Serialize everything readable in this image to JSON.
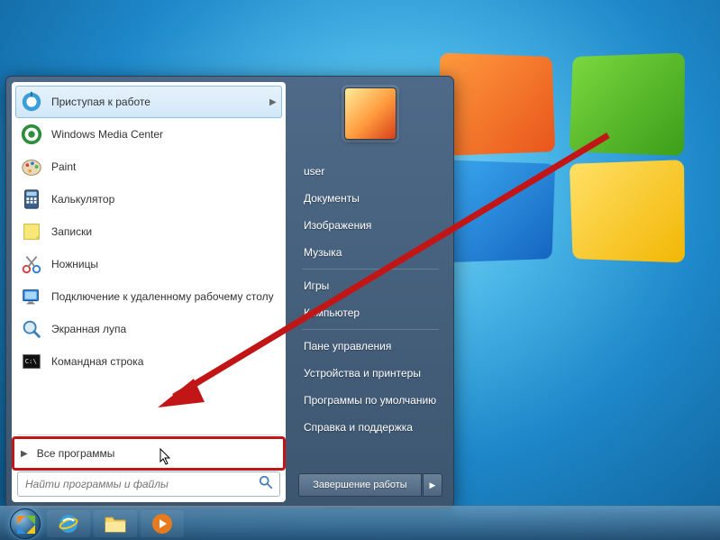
{
  "left_programs": [
    {
      "icon": "getting-started-icon",
      "label": "Приступая к работе",
      "has_submenu": true
    },
    {
      "icon": "media-center-icon",
      "label": "Windows Media Center",
      "has_submenu": false
    },
    {
      "icon": "paint-icon",
      "label": "Paint",
      "has_submenu": false
    },
    {
      "icon": "calculator-icon",
      "label": "Калькулятор",
      "has_submenu": false
    },
    {
      "icon": "sticky-notes-icon",
      "label": "Записки",
      "has_submenu": false
    },
    {
      "icon": "snipping-tool-icon",
      "label": "Ножницы",
      "has_submenu": false
    },
    {
      "icon": "remote-desktop-icon",
      "label": "Подключение к удаленному рабочему столу",
      "has_submenu": false
    },
    {
      "icon": "magnifier-icon",
      "label": "Экранная лупа",
      "has_submenu": false
    },
    {
      "icon": "command-prompt-icon",
      "label": "Командная строка",
      "has_submenu": false
    }
  ],
  "all_programs_label": "Все программы",
  "search_placeholder": "Найти программы и файлы",
  "right_items": {
    "user": "user",
    "documents": "Документы",
    "pictures": "Изображения",
    "music": "Музыка",
    "games": "Игры",
    "computer": "Компьютер",
    "control_panel": "Пане   управления",
    "devices": "Устройства и принтеры",
    "default_programs": "Программы по умолчанию",
    "help": "Справка и поддержка"
  },
  "shutdown_label": "Завершение работы"
}
